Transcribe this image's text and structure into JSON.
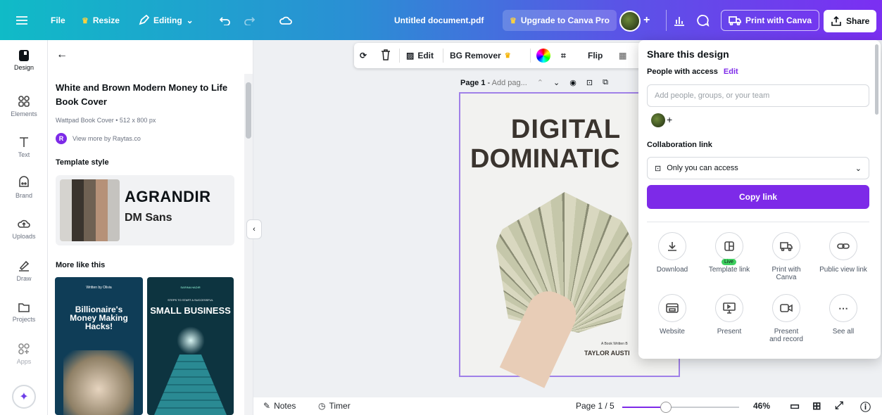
{
  "topbar": {
    "file": "File",
    "resize": "Resize",
    "editing": "Editing",
    "doc_title": "Untitled document.pdf",
    "upgrade": "Upgrade to Canva Pro",
    "print": "Print with Canva",
    "share": "Share"
  },
  "rail": {
    "items": [
      {
        "label": "Design",
        "icon": "design-icon"
      },
      {
        "label": "Elements",
        "icon": "elements-icon"
      },
      {
        "label": "Text",
        "icon": "text-icon"
      },
      {
        "label": "Brand",
        "icon": "brand-icon"
      },
      {
        "label": "Uploads",
        "icon": "uploads-icon"
      },
      {
        "label": "Draw",
        "icon": "draw-icon"
      },
      {
        "label": "Projects",
        "icon": "projects-icon"
      },
      {
        "label": "Apps",
        "icon": "apps-icon"
      }
    ]
  },
  "panel": {
    "title": "White and Brown Modern Money to Life Book Cover",
    "meta": "Wattpad Book Cover • 512 x 800 px",
    "author_initial": "R",
    "author": "View more by Raytas.co",
    "template_style": "Template style",
    "font_head": "AGRANDIR",
    "font_body": "DM Sans",
    "more_like": "More like this",
    "thumbs": [
      {
        "top": "Written by Olivia",
        "title": "Billionaire's Money Making Hacks!"
      },
      {
        "top": "STEPS TO START A SUCCESSFUL",
        "author": "SARINA HADIR",
        "title": "SMALL BUSINESS"
      }
    ],
    "colors": [
      "#d5d3cf",
      "#3a342e",
      "#6f6153",
      "#b69178",
      "#c5c3bf"
    ]
  },
  "toolbar": {
    "edit": "Edit",
    "bg_remover": "BG Remover",
    "flip": "Flip"
  },
  "page": {
    "label": "Page 1",
    "placeholder": "Add pag...",
    "title1": "DIGITAL",
    "title2": "DOMINATIC",
    "byline": "A Book Written B",
    "author": "TAYLOR AUSTI"
  },
  "bottom": {
    "notes": "Notes",
    "timer": "Timer",
    "page_count": "Page 1 / 5",
    "zoom": "46%",
    "zoom_level": 0.46
  },
  "share": {
    "title": "Share this design",
    "people": "People with access",
    "edit": "Edit",
    "placeholder": "Add people, groups, or your team",
    "collab": "Collaboration link",
    "access": "Only you can access",
    "copy": "Copy link",
    "live_badge": "Live",
    "options": [
      {
        "label": "Download",
        "icon": "download-icon"
      },
      {
        "label": "Template link",
        "icon": "template-link-icon"
      },
      {
        "label": "Print with Canva",
        "icon": "print-icon"
      },
      {
        "label": "Public view link",
        "icon": "link-icon"
      },
      {
        "label": "Website",
        "icon": "website-icon"
      },
      {
        "label": "Present",
        "icon": "present-icon"
      },
      {
        "label": "Present and record",
        "icon": "record-icon"
      },
      {
        "label": "See all",
        "icon": "more-icon"
      }
    ]
  },
  "colors": {
    "accent": "#7d2ae8",
    "live": "#3ecf5f"
  }
}
